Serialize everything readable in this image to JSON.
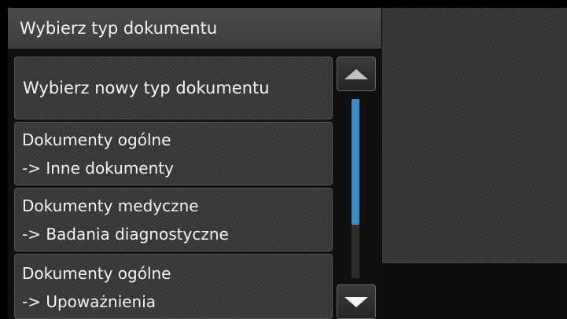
{
  "header": {
    "title": "Wybierz typ dokumentu"
  },
  "list": {
    "items": [
      {
        "line1": "Wybierz nowy typ dokumentu",
        "line2": ""
      },
      {
        "line1": "Dokumenty ogólne",
        "line2": "-> Inne dokumenty"
      },
      {
        "line1": "Dokumenty medyczne",
        "line2": "-> Badania diagnostyczne"
      },
      {
        "line1": "Dokumenty ogólne",
        "line2": "-> Upoważnienia"
      }
    ]
  },
  "scrollbar": {
    "up_icon": "triangle-up-icon",
    "down_icon": "triangle-down-icon",
    "thumb_color": "#3a8ec4"
  },
  "colors": {
    "background": "#000000",
    "text": "#f4f4f4"
  }
}
